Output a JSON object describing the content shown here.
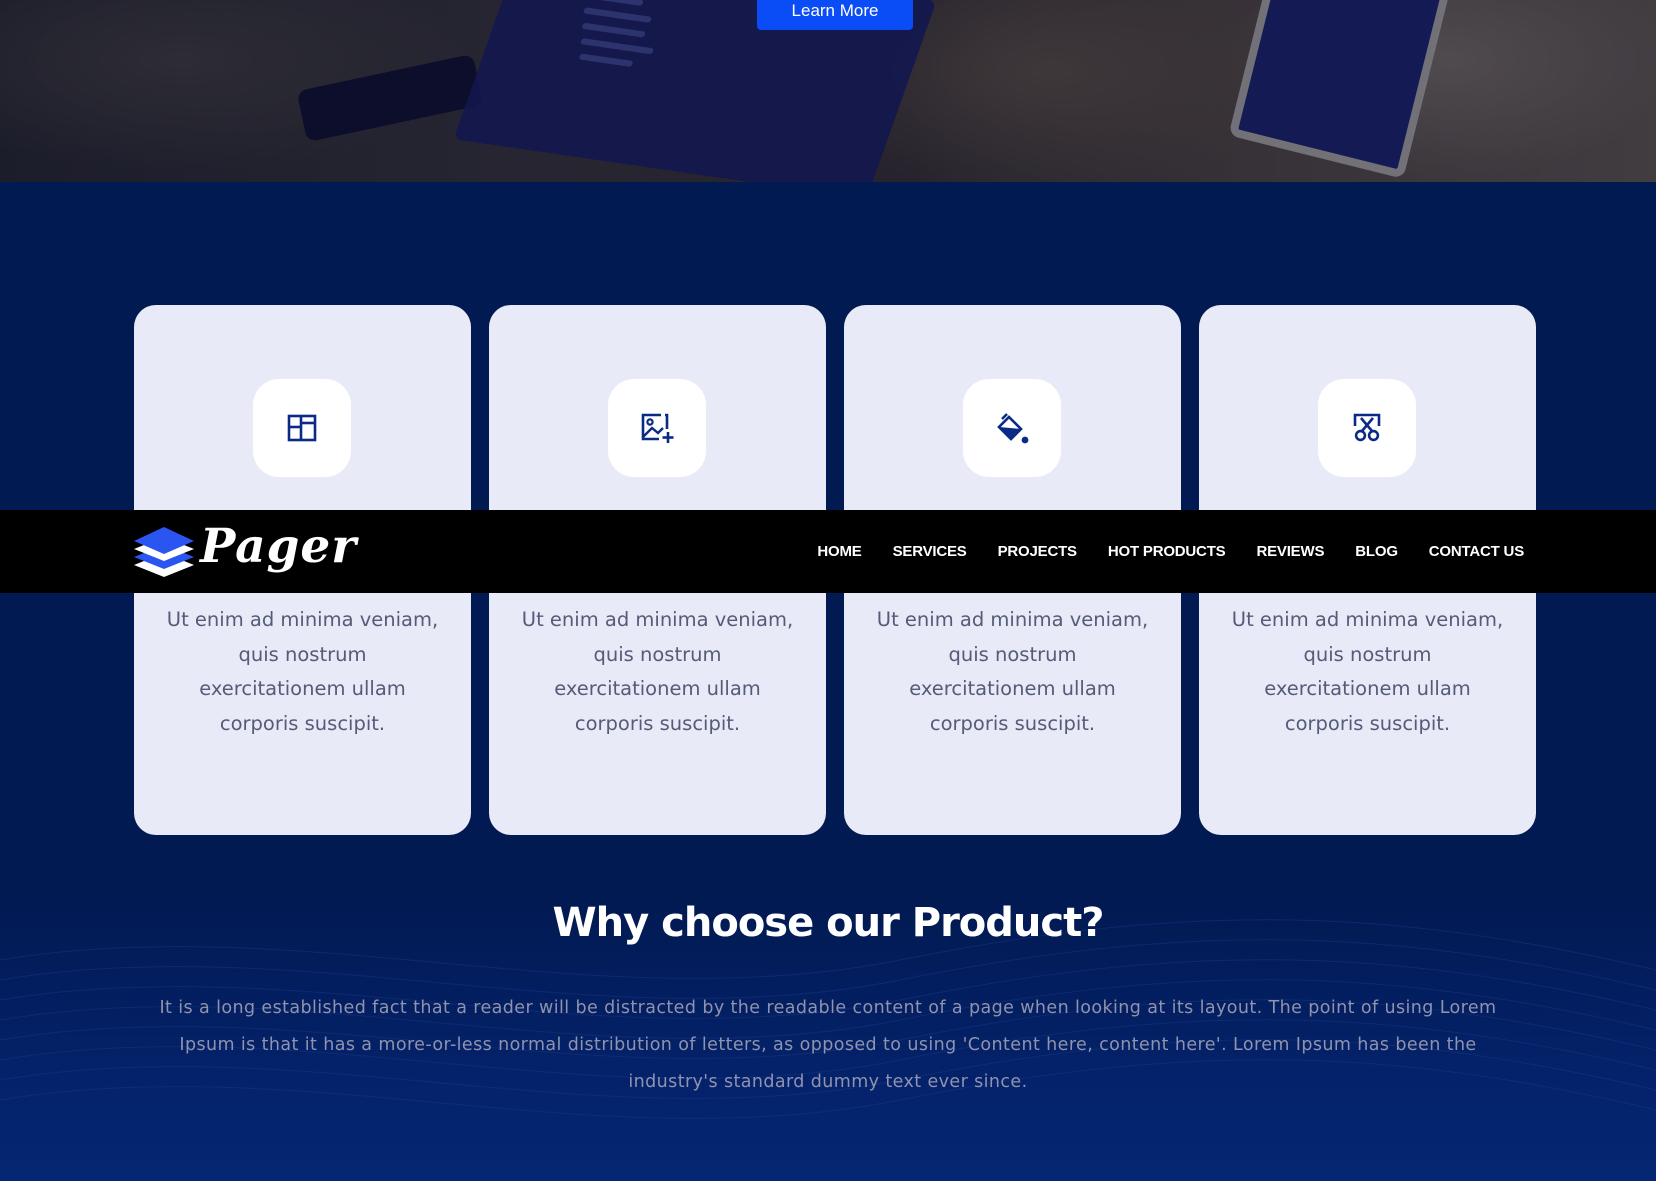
{
  "hero": {
    "learn_more_label": "Learn More"
  },
  "cards": [
    {
      "icon": "layout-icon",
      "description": "Ut enim ad minima veniam, quis nostrum exercitationem ullam corporis suscipit."
    },
    {
      "icon": "add-image-icon",
      "description": "Ut enim ad minima veniam, quis nostrum exercitationem ullam corporis suscipit."
    },
    {
      "icon": "paint-bucket-icon",
      "description": "Ut enim ad minima veniam, quis nostrum exercitationem ullam corporis suscipit."
    },
    {
      "icon": "scissors-icon",
      "description": "Ut enim ad minima veniam, quis nostrum exercitationem ullam corporis suscipit."
    }
  ],
  "navbar": {
    "logo_text": "Pager",
    "items": [
      "HOME",
      "SERVICES",
      "PROJECTS",
      "HOT PRODUCTS",
      "REVIEWS",
      "BLOG",
      "CONTACT US"
    ]
  },
  "why": {
    "title": "Why choose our Product?",
    "text": "It is a long established fact that a reader will be distracted by the readable content of a page when looking at its layout. The point of using Lorem Ipsum is that it has a more-or-less normal distribution of letters, as opposed to using 'Content here, content here'. Lorem Ipsum has been the industry's standard dummy text ever since."
  },
  "colors": {
    "page_background": "#021a52",
    "accent": "#0a4cf5",
    "card_background": "#e8eaf7",
    "icon_color": "#0b2a86",
    "navbar_background": "#000000"
  }
}
